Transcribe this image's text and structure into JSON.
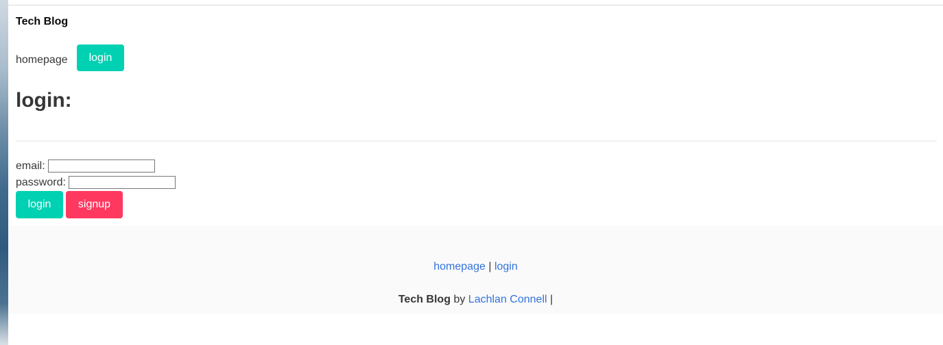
{
  "header": {
    "brand": "Tech Blog",
    "nav_homepage": "homepage",
    "nav_login": "login"
  },
  "main": {
    "title": "login:",
    "email_label": "email:",
    "email_value": "",
    "password_label": "password:",
    "password_value": "",
    "login_button": "login",
    "signup_button": "signup"
  },
  "footer": {
    "link_homepage": "homepage",
    "separator": "|",
    "link_login": "login",
    "brand": "Tech Blog",
    "by_text": "by",
    "author": "Lachlan Connell",
    "trailing": "|"
  },
  "colors": {
    "primary": "#00d1b2",
    "danger": "#ff3860",
    "link": "#3273dc",
    "text": "#363636",
    "footer_bg": "#fafafa"
  }
}
